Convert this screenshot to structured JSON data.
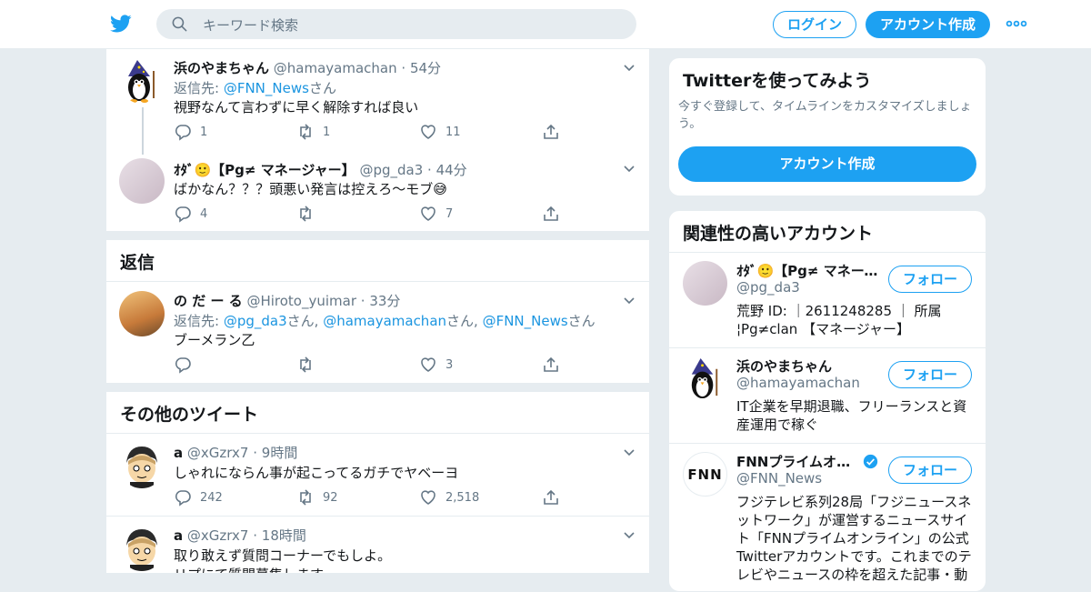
{
  "colors": {
    "brand": "#1da1f2",
    "link": "#1b95e0",
    "muted": "#657786",
    "text": "#14171a",
    "bg": "#e6ecf0"
  },
  "header": {
    "logo_icon": "twitter-bird-icon",
    "search_placeholder": "キーワード検索",
    "login_label": "ログイン",
    "signup_label": "アカウント作成",
    "more_icon": "more-dots-icon"
  },
  "thread": [
    {
      "name": "浜のやまちゃん",
      "handle": "@hamayamachan",
      "time": "· 54分",
      "reply_prefix": "返信先: ",
      "reply_link": "@FNN_News",
      "reply_suffix": "さん",
      "text": "視野なんて言わずに早く解除すれば良い",
      "replies": "1",
      "retweets": "1",
      "likes": "11"
    },
    {
      "name": "ｵﾀﾞ🙂【Pg≠ マネージャー】",
      "handle": "@pg_da3",
      "time": "· 44分",
      "text": "ばかなん？？？頭悪い発言は控えろ〜モブ😅",
      "replies": "4",
      "retweets": "",
      "likes": "7"
    }
  ],
  "replies_section": {
    "title": "返信",
    "tweet": {
      "name": "の だ ー る",
      "handle": "@Hiroto_yuimar",
      "time": "· 33分",
      "reply_prefix": "返信先: ",
      "reply_link1": "@pg_da3",
      "sep1": "さん, ",
      "reply_link2": "@hamayamachan",
      "sep2": "さん, ",
      "reply_link3": "@FNN_News",
      "reply_suffix": "さん",
      "text": "ブーメラン乙",
      "replies": "",
      "retweets": "",
      "likes": "3"
    }
  },
  "more_section": {
    "title": "その他のツイート",
    "tweets": [
      {
        "name": "a",
        "handle": "@xGzrx7",
        "time": "· 9時間",
        "text": "しゃれにならん事が起こってるガチでヤベーヨ",
        "replies": "242",
        "retweets": "92",
        "likes": "2,518"
      },
      {
        "name": "a",
        "handle": "@xGzrx7",
        "time": "· 18時間",
        "text": "取り敢えず質問コーナーでもしよ。",
        "text2": "リプにて質問募集します"
      }
    ]
  },
  "sidebar": {
    "signup_card": {
      "title": "Twitterを使ってみよう",
      "subtitle": "今すぐ登録して、タイムラインをカスタマイズしましょう。",
      "cta": "アカウント作成"
    },
    "related": {
      "title": "関連性の高いアカウント",
      "follow_label": "フォロー",
      "accounts": [
        {
          "name": "ｵﾀﾞ🙂【Pg≠ マネージャー】",
          "handle": "@pg_da3",
          "bio": "荒野 ID: ｜2611248285 ｜ 所属¦Pg≠clan 【マネージャー】",
          "verified": false
        },
        {
          "name": "浜のやまちゃん",
          "handle": "@hamayamachan",
          "bio": "IT企業を早期退職、フリーランスと資産運用で稼ぐ",
          "verified": false
        },
        {
          "name": "FNNプライムオンライン",
          "handle": "@FNN_News",
          "bio": "フジテレビ系列28局「フジニュースネットワーク」が運営するニュースサイト「FNNプライムオンライン」の公式Twitterアカウントです。これまでのテレビやニュースの枠を超えた記事・動",
          "verified": true,
          "logo_text": "FNN"
        }
      ]
    }
  }
}
